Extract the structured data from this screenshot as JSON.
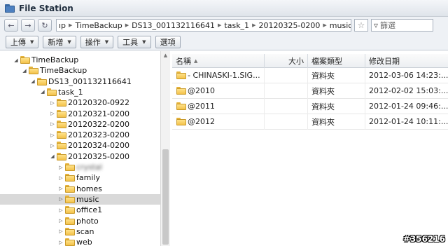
{
  "window": {
    "title": "File Station"
  },
  "nav": {
    "breadcrumbs": [
      "ıp",
      "TimeBackup",
      "DS13_001132116641",
      "task_1",
      "20120325-0200",
      "music"
    ],
    "search_placeholder": "篩選"
  },
  "toolbar": {
    "upload": "上傳",
    "create": "新增",
    "action": "操作",
    "tools": "工具",
    "options": "選項"
  },
  "tree": [
    {
      "label": "TimeBackup",
      "expander": "expanded",
      "level": 0
    },
    {
      "label": "TimeBackup",
      "expander": "expanded",
      "level": 1
    },
    {
      "label": "DS13_001132116641",
      "expander": "expanded",
      "level": 2
    },
    {
      "label": "task_1",
      "expander": "expanded",
      "level": 3
    },
    {
      "label": "20120320-0922",
      "expander": "collapsed",
      "level": 4
    },
    {
      "label": "20120321-0200",
      "expander": "collapsed",
      "level": 4
    },
    {
      "label": "20120322-0200",
      "expander": "collapsed",
      "level": 4
    },
    {
      "label": "20120323-0200",
      "expander": "collapsed",
      "level": 4
    },
    {
      "label": "20120324-0200",
      "expander": "collapsed",
      "level": 4
    },
    {
      "label": "20120325-0200",
      "expander": "expanded",
      "level": 4
    },
    {
      "label": "crystal",
      "expander": "collapsed",
      "level": 5,
      "blurred": true
    },
    {
      "label": "family",
      "expander": "collapsed",
      "level": 5
    },
    {
      "label": "homes",
      "expander": "collapsed",
      "level": 5
    },
    {
      "label": "music",
      "expander": "collapsed",
      "level": 5,
      "selected": true
    },
    {
      "label": "office1",
      "expander": "collapsed",
      "level": 5
    },
    {
      "label": "photo",
      "expander": "collapsed",
      "level": 5
    },
    {
      "label": "scan",
      "expander": "collapsed",
      "level": 5
    },
    {
      "label": "web",
      "expander": "collapsed",
      "level": 5
    }
  ],
  "list": {
    "columns": {
      "name": "名稱",
      "size": "大小",
      "type": "檔案類型",
      "modified": "修改日期"
    },
    "rows": [
      {
        "name": "- CHINASKI-1.SIG...",
        "size": "",
        "type": "資料夾",
        "modified": "2012-03-06 14:23:..."
      },
      {
        "name": "@2010",
        "size": "",
        "type": "資料夾",
        "modified": "2012-02-02 15:03:..."
      },
      {
        "name": "@2011",
        "size": "",
        "type": "資料夾",
        "modified": "2012-01-24 09:46:..."
      },
      {
        "name": "@2012",
        "size": "",
        "type": "資料夾",
        "modified": "2012-01-24 10:11:..."
      }
    ]
  },
  "watermark": "#356216"
}
